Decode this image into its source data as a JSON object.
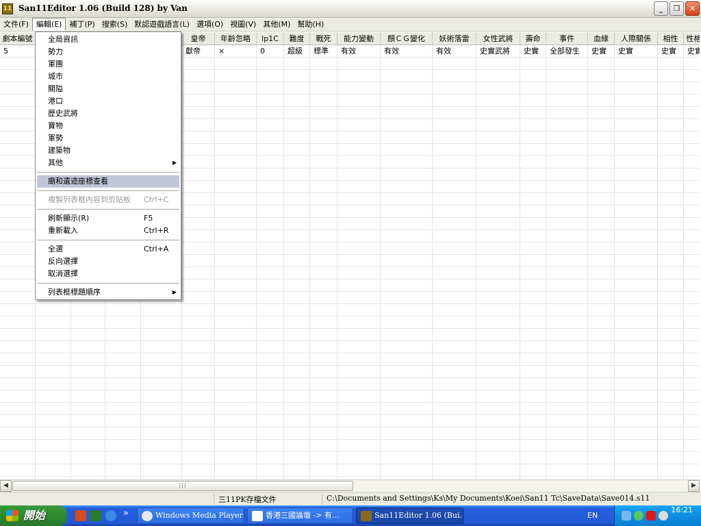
{
  "window": {
    "title": "San11Editor 1.06 (Build 128) by Van",
    "icon_text": "11"
  },
  "menubar": {
    "items": [
      "文件(F)",
      "編輯(E)",
      "補丁(P)",
      "搜索(S)",
      "默認遊戲語言(L)",
      "選項(O)",
      "視圖(V)",
      "其他(M)",
      "幫助(H)"
    ],
    "active": "編輯(E)"
  },
  "columns": [
    "劇本編號",
    "",
    "",
    "",
    "",
    "皇帝",
    "年齡忽略",
    "lp1C",
    "難度",
    "戰死",
    "能力變動",
    "顏ＣＧ變化",
    "妖術落雷",
    "女性武將",
    "壽命",
    "事件",
    "血緣",
    "人際關係",
    "相性",
    "性格"
  ],
  "row": [
    "5",
    "",
    "",
    "",
    "",
    "獻帝",
    "×",
    "0",
    "超級",
    "標準",
    "有效",
    "有效",
    "有效",
    "史實武將",
    "史實",
    "全部發生",
    "史實",
    "史實",
    "史實",
    "史實"
  ],
  "edit_menu": {
    "items": [
      {
        "label": "全局資訊",
        "shortcut": "",
        "submenu": false
      },
      {
        "label": "勢力",
        "shortcut": "",
        "submenu": false
      },
      {
        "label": "軍團",
        "shortcut": "",
        "submenu": false
      },
      {
        "label": "城市",
        "shortcut": "",
        "submenu": false
      },
      {
        "label": "關隘",
        "shortcut": "",
        "submenu": false
      },
      {
        "label": "港口",
        "shortcut": "",
        "submenu": false
      },
      {
        "label": "歷史武將",
        "shortcut": "",
        "submenu": false
      },
      {
        "label": "寶物",
        "shortcut": "",
        "submenu": false
      },
      {
        "label": "軍勢",
        "shortcut": "",
        "submenu": false
      },
      {
        "label": "建築物",
        "shortcut": "",
        "submenu": false
      },
      {
        "label": "其他",
        "shortcut": "",
        "submenu": true
      },
      {
        "label": "廟和遺迹座標查看",
        "shortcut": "",
        "submenu": false,
        "highlighted": true
      },
      {
        "label": "複製列表框內容到剪貼板",
        "shortcut": "Ctrl+C",
        "submenu": false,
        "disabled": true
      },
      {
        "label": "刷新顯示(R)",
        "shortcut": "F5",
        "submenu": false
      },
      {
        "label": "重新載入",
        "shortcut": "Ctrl+R",
        "submenu": false
      },
      {
        "label": "全選",
        "shortcut": "Ctrl+A",
        "submenu": false
      },
      {
        "label": "反向選擇",
        "shortcut": "",
        "submenu": false
      },
      {
        "label": "取消選擇",
        "shortcut": "",
        "submenu": false
      },
      {
        "label": "列表框標題順序",
        "shortcut": "",
        "submenu": true
      }
    ]
  },
  "scrollbar": {
    "left_arrow": "◀",
    "right_arrow": "▶",
    "thumb_grip": "|||"
  },
  "statusbar": {
    "file_type": "三11PK存檔文件",
    "path": "C:\\Documents and Settings\\Ks\\My Documents\\Koei\\San11 Tc\\SaveData\\Save014.s11"
  },
  "taskbar": {
    "start_label": "開始",
    "overflow": "»",
    "buttons": [
      {
        "label": "Windows Media Player",
        "icon": "media-player-icon"
      },
      {
        "label": "香港三國論壇 -> 有...",
        "icon": "browser-icon"
      },
      {
        "label": "San11Editor 1.06 (Bui...",
        "icon": "app-icon",
        "active": true
      }
    ],
    "language": "EN",
    "clock": "16:21"
  },
  "colors": {
    "menu_highlight": "#c1c5d8",
    "taskbar": "#245edb",
    "start": "#2d8a2d",
    "tray": "#0f8de0"
  }
}
